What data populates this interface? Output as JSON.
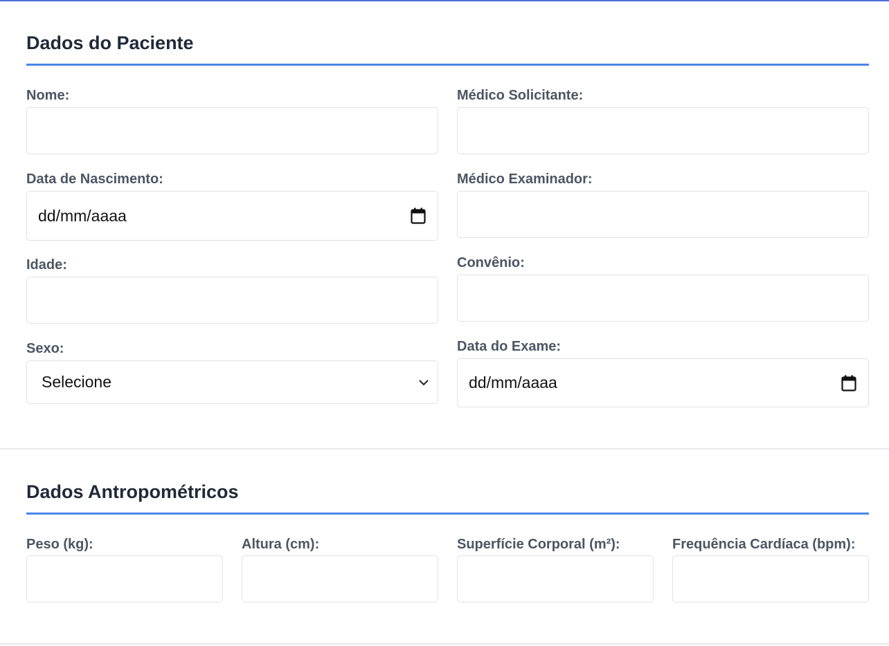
{
  "patient_section": {
    "title": "Dados do Paciente",
    "fields": {
      "nome": {
        "label": "Nome:",
        "value": ""
      },
      "medico_solicitante": {
        "label": "Médico Solicitante:",
        "value": ""
      },
      "data_nascimento": {
        "label": "Data de Nascimento:",
        "placeholder": "dd/mm/aaaa",
        "icon": "calendar-icon"
      },
      "medico_examinador": {
        "label": "Médico Examinador:",
        "value": ""
      },
      "idade": {
        "label": "Idade:",
        "value": ""
      },
      "convenio": {
        "label": "Convênio:",
        "value": ""
      },
      "sexo": {
        "label": "Sexo:",
        "selected": "Selecione",
        "icon": "chevron-down-icon"
      },
      "data_exame": {
        "label": "Data do Exame:",
        "placeholder": "dd/mm/aaaa",
        "icon": "calendar-icon"
      }
    }
  },
  "anthropometric_section": {
    "title": "Dados Antropométricos",
    "fields": {
      "peso": {
        "label": "Peso (kg):",
        "value": ""
      },
      "altura": {
        "label": "Altura (cm):",
        "value": ""
      },
      "superficie_corporal": {
        "label": "Superfície Corporal (m²):",
        "value": ""
      },
      "frequencia_cardiaca": {
        "label": "Frequência Cardíaca (bpm):",
        "value": ""
      }
    }
  },
  "colors": {
    "accent": "#4a86e8",
    "label": "#4b5563",
    "title": "#1f2937",
    "input_border": "#dfe2e6"
  }
}
